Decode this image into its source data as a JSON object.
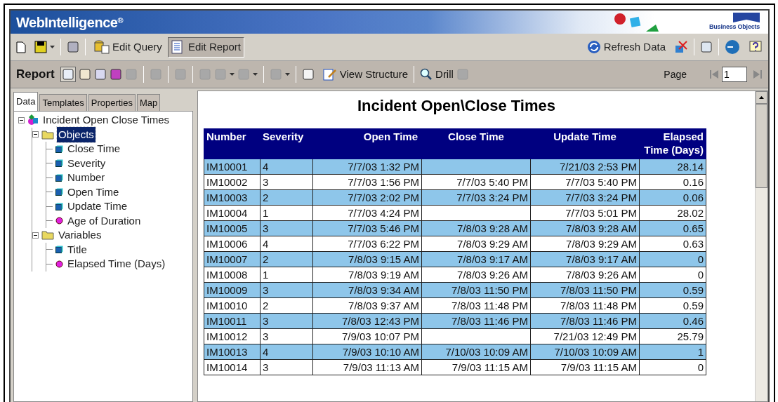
{
  "window": {
    "title": "WebIntelligence",
    "title_mark": "®",
    "brand": "Business Objects"
  },
  "toolbar1": {
    "buttons": [
      {
        "label": "Edit Query",
        "selected": false
      },
      {
        "label": "Edit Report",
        "selected": true
      }
    ],
    "refresh": "Refresh Data"
  },
  "toolbar2": {
    "label": "Report",
    "view_structure": "View Structure",
    "drill": "Drill",
    "page_label": "Page",
    "page_value": "1"
  },
  "tabs": [
    {
      "label": "Data",
      "selected": true
    },
    {
      "label": "Templates",
      "selected": false
    },
    {
      "label": "Properties",
      "selected": false
    },
    {
      "label": "Map",
      "selected": false
    }
  ],
  "tree": [
    {
      "label": "Incident Open Close Times",
      "kind": "root",
      "selected": false,
      "children": [
        {
          "label": "Objects",
          "kind": "folder",
          "selected": true,
          "children": [
            {
              "label": "Close Time",
              "kind": "object",
              "selected": false
            },
            {
              "label": "Severity",
              "kind": "object",
              "selected": false
            },
            {
              "label": "Number",
              "kind": "object",
              "selected": false
            },
            {
              "label": "Open Time",
              "kind": "object",
              "selected": false
            },
            {
              "label": "Update Time",
              "kind": "object",
              "selected": false
            },
            {
              "label": "Age of Duration",
              "kind": "measure",
              "selected": false
            }
          ]
        },
        {
          "label": "Variables",
          "kind": "folder",
          "selected": false,
          "children": [
            {
              "label": "Title",
              "kind": "object",
              "selected": false
            },
            {
              "label": "Elapsed Time (Days)",
              "kind": "measure",
              "selected": false
            }
          ]
        }
      ]
    }
  ],
  "report": {
    "title": "Incident Open\\Close Times",
    "columns": [
      "Number",
      "Severity",
      "Open Time",
      "Close Time",
      "Update Time",
      "Elapsed Time (Days)"
    ],
    "rows": [
      [
        "IM10001",
        "4",
        "7/7/03 1:32 PM",
        "",
        "7/21/03 2:53 PM",
        "28.14"
      ],
      [
        "IM10002",
        "3",
        "7/7/03 1:56 PM",
        "7/7/03 5:40 PM",
        "7/7/03 5:40 PM",
        "0.16"
      ],
      [
        "IM10003",
        "2",
        "7/7/03 2:02 PM",
        "7/7/03 3:24 PM",
        "7/7/03 3:24 PM",
        "0.06"
      ],
      [
        "IM10004",
        "1",
        "7/7/03 4:24 PM",
        "",
        "7/7/03 5:01 PM",
        "28.02"
      ],
      [
        "IM10005",
        "3",
        "7/7/03 5:46 PM",
        "7/8/03 9:28 AM",
        "7/8/03 9:28 AM",
        "0.65"
      ],
      [
        "IM10006",
        "4",
        "7/7/03 6:22 PM",
        "7/8/03 9:29 AM",
        "7/8/03 9:29 AM",
        "0.63"
      ],
      [
        "IM10007",
        "2",
        "7/8/03 9:15 AM",
        "7/8/03 9:17 AM",
        "7/8/03 9:17 AM",
        "0"
      ],
      [
        "IM10008",
        "1",
        "7/8/03 9:19 AM",
        "7/8/03 9:26 AM",
        "7/8/03 9:26 AM",
        "0"
      ],
      [
        "IM10009",
        "3",
        "7/8/03 9:34 AM",
        "7/8/03 11:50 PM",
        "7/8/03 11:50 PM",
        "0.59"
      ],
      [
        "IM10010",
        "2",
        "7/8/03 9:37 AM",
        "7/8/03 11:48 PM",
        "7/8/03 11:48 PM",
        "0.59"
      ],
      [
        "IM10011",
        "3",
        "7/8/03 12:43 PM",
        "7/8/03 11:46 PM",
        "7/8/03 11:46 PM",
        "0.46"
      ],
      [
        "IM10012",
        "3",
        "7/9/03 10:07 PM",
        "",
        "7/21/03 12:49 PM",
        "25.79"
      ],
      [
        "IM10013",
        "4",
        "7/9/03 10:10 AM",
        "7/10/03 10:09 AM",
        "7/10/03 10:09 AM",
        "1"
      ],
      [
        "IM10014",
        "3",
        "7/9/03 11:13 AM",
        "7/9/03 11:15 AM",
        "7/9/03 11:15 AM",
        "0"
      ]
    ]
  }
}
